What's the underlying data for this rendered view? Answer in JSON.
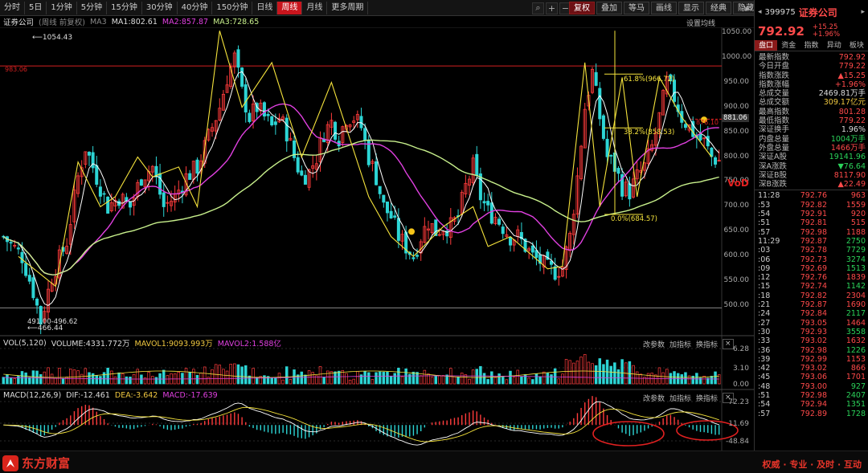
{
  "toolbar": {
    "timeframes": [
      "分时",
      "5日",
      "1分钟",
      "5分钟",
      "15分钟",
      "30分钟",
      "40分钟",
      "150分钟",
      "日线",
      "周线",
      "月线",
      "更多周期"
    ],
    "active_timeframe": "周线",
    "right_buttons": [
      "复权",
      "叠加",
      "等马",
      "画线",
      "显示",
      "经典",
      "隐藏"
    ]
  },
  "main_info": {
    "name": "证券公司",
    "note": "(周线 前复权)",
    "ma1": "MA1:802.61",
    "ma2": "MA2:857.87",
    "ma3": "MA3:728.65",
    "settings": "设置均线"
  },
  "annotations": {
    "high": "1054.43",
    "low": "466.44",
    "low_range": "491.00-496.62",
    "fib618": "61.8%(966.72)",
    "fib382": "38.2%(858.53)",
    "fib0": "0.0%(684.57)",
    "hline_left": "983.06",
    "hline_right": "876.10",
    "cur_label": "881.06",
    "vd": "VoD"
  },
  "main_axis": [
    "1050.00",
    "1000.00",
    "950.00",
    "900.00",
    "850.00",
    "800.00",
    "750.00",
    "700.00",
    "650.00",
    "600.00",
    "550.00",
    "500.00"
  ],
  "vol_info": {
    "name": "VOL(5,120)",
    "volume": "VOLUME:4331.772万",
    "mavol1": "MAVOL1:9093.993万",
    "mavol2": "MAVOL2:1.588亿"
  },
  "vol_axis": [
    "6.28",
    "3.10",
    "0.00"
  ],
  "macd_info": {
    "name": "MACD(12,26,9)",
    "dif": "DIF:-12.461",
    "dea": "DEA:-3.642",
    "macd": "MACD:-17.639"
  },
  "macd_axis": [
    "72.23",
    "11.69",
    "-48.84"
  ],
  "panel_buttons": [
    "改参数",
    "加指标",
    "换指标"
  ],
  "colors": {
    "ma1": "#ffffff",
    "ma2": "#e040e0",
    "ma3": "#c8f08c",
    "up": "#ff3b3b",
    "down": "#2dd5d5",
    "yellow": "#f5e33c",
    "red_line": "#d42020"
  },
  "right": {
    "code": "399975",
    "name": "证券公司",
    "price": "792.92",
    "change": "+15.25",
    "change_pct": "+1.96%",
    "tabs": [
      "盘口",
      "资金",
      "指数",
      "异动",
      "板块"
    ],
    "quotes": [
      {
        "label": "最新指数",
        "value": "792.92",
        "c": "up"
      },
      {
        "label": "今日开盘",
        "value": "779.22",
        "c": "up"
      },
      {
        "label": "指数涨跌",
        "value": "▲15.25",
        "c": "up"
      },
      {
        "label": "指数涨幅",
        "value": "+1.96%",
        "c": "up"
      },
      {
        "label": "总成交量",
        "value": "2469.81万手",
        "c": "wh"
      },
      {
        "label": "总成交额",
        "value": "309.17亿元",
        "c": "yl"
      },
      {
        "label": "最高指数",
        "value": "801.28",
        "c": "up"
      },
      {
        "label": "最低指数",
        "value": "779.22",
        "c": "up"
      },
      {
        "label": "深证换手",
        "value": "1.96%",
        "c": "wh"
      },
      {
        "label": "内盘总量",
        "value": "1004万手",
        "c": "dn"
      },
      {
        "label": "外盘总量",
        "value": "1466万手",
        "c": "up"
      },
      {
        "label": "深证A股",
        "value": "19141.96",
        "c": "dn"
      },
      {
        "label": "深A涨跌",
        "value": "▼76.64",
        "c": "dn"
      },
      {
        "label": "深证B股",
        "value": "8117.90",
        "c": "up"
      },
      {
        "label": "深B涨跌",
        "value": "▲22.49",
        "c": "up"
      }
    ],
    "ticks": [
      {
        "t": "11:28",
        "p": "792.76",
        "v": "963",
        "pc": "up",
        "vc": "up"
      },
      {
        "t": ":53",
        "p": "792.82",
        "v": "1559",
        "pc": "up",
        "vc": "up"
      },
      {
        "t": ":54",
        "p": "792.91",
        "v": "920",
        "pc": "up",
        "vc": "up"
      },
      {
        "t": ":51",
        "p": "792.81",
        "v": "515",
        "pc": "up",
        "vc": "up"
      },
      {
        "t": ":57",
        "p": "792.98",
        "v": "1188",
        "pc": "up",
        "vc": "up"
      },
      {
        "t": "11:29",
        "p": "792.87",
        "v": "2750",
        "pc": "up",
        "vc": "dn"
      },
      {
        "t": ":03",
        "p": "792.78",
        "v": "7729",
        "pc": "up",
        "vc": "dn"
      },
      {
        "t": ":06",
        "p": "792.73",
        "v": "3274",
        "pc": "up",
        "vc": "dn"
      },
      {
        "t": ":09",
        "p": "792.69",
        "v": "1513",
        "pc": "up",
        "vc": "dn"
      },
      {
        "t": ":12",
        "p": "792.76",
        "v": "1839",
        "pc": "up",
        "vc": "up"
      },
      {
        "t": ":15",
        "p": "792.74",
        "v": "1142",
        "pc": "up",
        "vc": "dn"
      },
      {
        "t": ":18",
        "p": "792.82",
        "v": "2304",
        "pc": "up",
        "vc": "up"
      },
      {
        "t": ":21",
        "p": "792.87",
        "v": "1690",
        "pc": "up",
        "vc": "up"
      },
      {
        "t": ":24",
        "p": "792.84",
        "v": "2117",
        "pc": "up",
        "vc": "dn"
      },
      {
        "t": ":27",
        "p": "793.05",
        "v": "1464",
        "pc": "up",
        "vc": "up"
      },
      {
        "t": ":30",
        "p": "792.93",
        "v": "3558",
        "pc": "up",
        "vc": "dn"
      },
      {
        "t": ":33",
        "p": "793.02",
        "v": "1632",
        "pc": "up",
        "vc": "up"
      },
      {
        "t": ":36",
        "p": "792.98",
        "v": "1226",
        "pc": "up",
        "vc": "dn"
      },
      {
        "t": ":39",
        "p": "792.99",
        "v": "1153",
        "pc": "up",
        "vc": "up"
      },
      {
        "t": ":42",
        "p": "793.02",
        "v": "866",
        "pc": "up",
        "vc": "up"
      },
      {
        "t": ":45",
        "p": "793.06",
        "v": "1701",
        "pc": "up",
        "vc": "up"
      },
      {
        "t": ":48",
        "p": "793.00",
        "v": "927",
        "pc": "up",
        "vc": "dn"
      },
      {
        "t": ":51",
        "p": "792.98",
        "v": "2407",
        "pc": "up",
        "vc": "dn"
      },
      {
        "t": ":54",
        "p": "792.94",
        "v": "1351",
        "pc": "up",
        "vc": "dn"
      },
      {
        "t": ":57",
        "p": "792.89",
        "v": "1728",
        "pc": "up",
        "vc": "dn"
      }
    ]
  },
  "footer": {
    "brand": "东方财富",
    "slogan": "权威 · 专业 · 及时 · 互动"
  },
  "chart_data": {
    "type": "candlestick",
    "timeframe": "weekly",
    "ylim": [
      466.44,
      1054.43
    ],
    "close_path_points": [
      [
        0,
        640
      ],
      [
        5,
        600
      ],
      [
        8,
        530
      ],
      [
        10,
        470
      ],
      [
        13,
        560
      ],
      [
        17,
        630
      ],
      [
        20,
        760
      ],
      [
        22,
        820
      ],
      [
        25,
        760
      ],
      [
        28,
        700
      ],
      [
        31,
        720
      ],
      [
        34,
        700
      ],
      [
        37,
        760
      ],
      [
        40,
        780
      ],
      [
        43,
        700
      ],
      [
        46,
        720
      ],
      [
        49,
        760
      ],
      [
        52,
        780
      ],
      [
        55,
        840
      ],
      [
        58,
        900
      ],
      [
        60,
        960
      ],
      [
        62,
        1000
      ],
      [
        64,
        930
      ],
      [
        66,
        880
      ],
      [
        68,
        900
      ],
      [
        70,
        880
      ],
      [
        72,
        860
      ],
      [
        74,
        880
      ],
      [
        76,
        850
      ],
      [
        78,
        800
      ],
      [
        80,
        760
      ],
      [
        82,
        770
      ],
      [
        84,
        800
      ],
      [
        86,
        850
      ],
      [
        88,
        870
      ],
      [
        90,
        840
      ],
      [
        92,
        880
      ],
      [
        94,
        880
      ],
      [
        96,
        860
      ],
      [
        98,
        800
      ],
      [
        100,
        760
      ],
      [
        102,
        700
      ],
      [
        104,
        680
      ],
      [
        106,
        640
      ],
      [
        108,
        620
      ],
      [
        110,
        600
      ],
      [
        112,
        640
      ],
      [
        114,
        670
      ],
      [
        116,
        650
      ],
      [
        118,
        660
      ],
      [
        120,
        660
      ],
      [
        122,
        680
      ],
      [
        124,
        740
      ],
      [
        126,
        780
      ],
      [
        128,
        720
      ],
      [
        130,
        690
      ],
      [
        132,
        680
      ],
      [
        134,
        660
      ],
      [
        136,
        640
      ],
      [
        138,
        640
      ],
      [
        140,
        620
      ],
      [
        142,
        600
      ],
      [
        144,
        590
      ],
      [
        146,
        575
      ],
      [
        148,
        570
      ],
      [
        150,
        580
      ],
      [
        152,
        640
      ],
      [
        154,
        760
      ],
      [
        156,
        900
      ],
      [
        158,
        970
      ],
      [
        160,
        880
      ],
      [
        162,
        800
      ],
      [
        164,
        780
      ],
      [
        166,
        740
      ],
      [
        168,
        730
      ],
      [
        170,
        760
      ],
      [
        172,
        780
      ],
      [
        174,
        820
      ],
      [
        176,
        880
      ],
      [
        178,
        950
      ],
      [
        180,
        920
      ],
      [
        182,
        880
      ],
      [
        184,
        860
      ],
      [
        186,
        840
      ],
      [
        188,
        830
      ],
      [
        190,
        800
      ],
      [
        192,
        793
      ]
    ],
    "indicators": {
      "ma1": 802.61,
      "ma2": 857.87,
      "ma3": 728.65,
      "volume": "4331.772万",
      "mavol1": "9093.993万",
      "mavol2": "1.588亿",
      "dif": -12.461,
      "dea": -3.642,
      "macd": -17.639
    },
    "fibonacci": [
      {
        "level": "61.8%",
        "value": 966.72
      },
      {
        "level": "38.2%",
        "value": 858.53
      },
      {
        "level": "0.0%",
        "value": 684.57
      }
    ],
    "vol_ylim": [
      0,
      6.28
    ],
    "macd_ylim": [
      -48.84,
      72.23
    ]
  }
}
